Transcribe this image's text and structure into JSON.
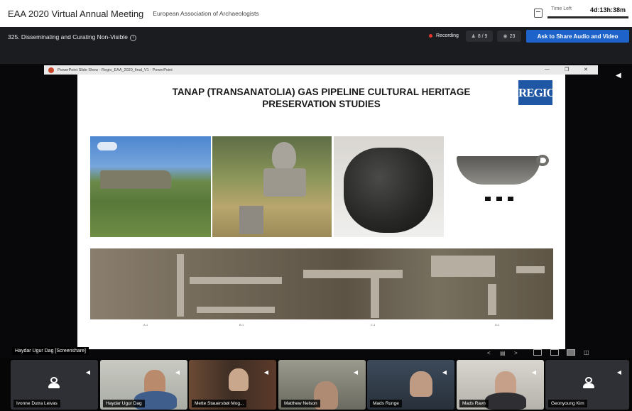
{
  "app": {
    "title": "EAA 2020 Virtual Annual Meeting",
    "organization": "European Association of Archaeologists",
    "time_left_label": "Time Left",
    "time_left_value": "4d:13h:38m"
  },
  "session": {
    "title": "325. Disseminating and Curating Non-Visible",
    "info_icon": "info-icon",
    "recording_label": "Recording",
    "participants_count": "8 / 9",
    "viewers_count": "23",
    "ask_button_label": "Ask to Share Audio and Video"
  },
  "screenshare": {
    "window_title": "PowerPoint Slide Show  -  Regio_EAA_2020_final_V1  -  PowerPoint",
    "sharer_label": "Haydar Ugur Dag [Screenshare]",
    "slide": {
      "title_line1": "TANAP (TRANSANATOLIA) GAS PIPELINE CULTURAL HERITAGE",
      "title_line2": "PRESERVATION STUDIES",
      "logo_text": "REGIO",
      "photo_captions": [
        "A-1",
        "B-1",
        "C-1",
        "D-1"
      ]
    }
  },
  "participants": [
    {
      "name": "Ivonne Dutra Leivas",
      "video": false
    },
    {
      "name": "Haydar Ugur Dag",
      "video": true
    },
    {
      "name": "Mette Stauersbøl Mog...",
      "video": true
    },
    {
      "name": "Matthew Nelson",
      "video": true
    },
    {
      "name": "Mads Runge",
      "video": true
    },
    {
      "name": "Mads Ravn",
      "video": true
    },
    {
      "name": "Geonyoung Kim",
      "video": false
    }
  ],
  "colors": {
    "accent": "#1e63c9",
    "recording": "#e5362e",
    "regio_brand": "#1f57a4"
  }
}
